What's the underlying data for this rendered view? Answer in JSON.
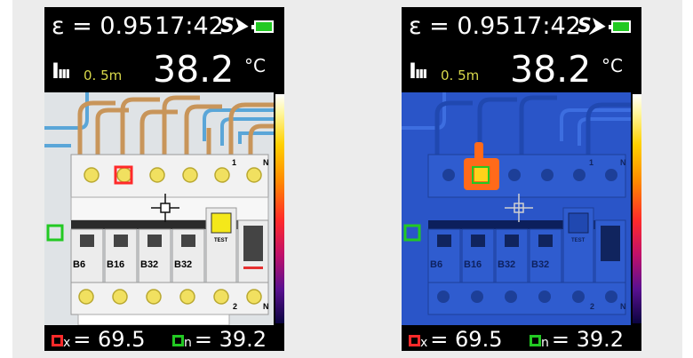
{
  "screens": [
    {
      "mode": "visual",
      "emissivity": "ε = 0.95",
      "clock": "17:42",
      "sd_label": "S⮞",
      "distance": "0. 5m",
      "temperature": "38.2",
      "unit": "°C",
      "max_label": "x",
      "max_value": "= 69.5",
      "min_label": "n",
      "min_value": "= 39.2",
      "breakers": [
        "B6",
        "B16",
        "B32",
        "B32"
      ],
      "test_label": "TEST"
    },
    {
      "mode": "thermal",
      "emissivity": "ε = 0.95",
      "clock": "17:42",
      "sd_label": "S⮞",
      "distance": "0. 5m",
      "temperature": "38.2",
      "unit": "°C",
      "max_label": "x",
      "max_value": "= 69.5",
      "min_label": "n",
      "min_value": "= 39.2",
      "breakers": [
        "B6",
        "B16",
        "B32",
        "B32"
      ],
      "test_label": "TEST"
    }
  ],
  "colors": {
    "max_marker": "#ff2a2a",
    "min_marker": "#22c922",
    "battery": "#22c922",
    "distance_text": "#d8d84a",
    "thermal_base": "#2a55c8",
    "hotspot": "#ff6a1a"
  }
}
